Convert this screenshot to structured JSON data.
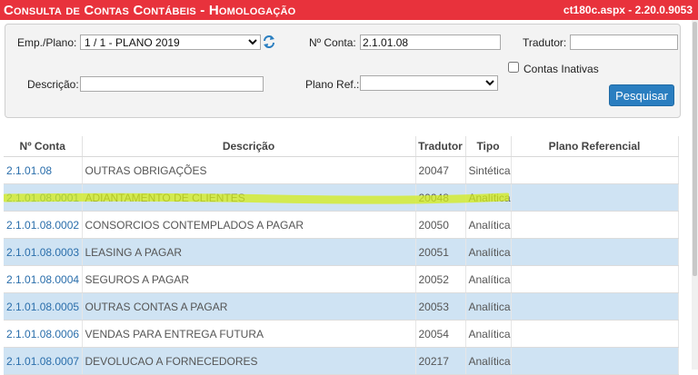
{
  "header": {
    "title": "Consulta de Contas Contábeis  - Homologação",
    "version": "ct180c.aspx - 2.20.0.9053",
    "color": "#e8323c"
  },
  "filters": {
    "emp_plano_label": "Emp./Plano:",
    "emp_plano_value": "1 / 1 - PLANO 2019",
    "conta_label": "Nº Conta:",
    "conta_value": "2.1.01.08",
    "tradutor_label": "Tradutor:",
    "tradutor_value": "",
    "contas_inativas_label": "Contas Inativas",
    "contas_inativas_checked": false,
    "descricao_label": "Descrição:",
    "descricao_value": "",
    "plano_ref_label": "Plano Ref.:",
    "plano_ref_value": "",
    "search_button": "Pesquisar",
    "refresh_icon": "refresh-icon"
  },
  "table": {
    "columns": [
      "Nº Conta",
      "Descrição",
      "Tradutor",
      "Tipo",
      "Plano Referencial"
    ],
    "rows": [
      {
        "conta": "2.1.01.08",
        "descricao": "OUTRAS OBRIGAÇÕES",
        "tradutor": "20047",
        "tipo": "Sintética",
        "plano_ref": ""
      },
      {
        "conta": "2.1.01.08.0001",
        "descricao": "ADIANTAMENTO DE CLIENTES",
        "tradutor": "20048",
        "tipo": "Analítica",
        "plano_ref": ""
      },
      {
        "conta": "2.1.01.08.0002",
        "descricao": "CONSORCIOS CONTEMPLADOS A PAGAR",
        "tradutor": "20050",
        "tipo": "Analítica",
        "plano_ref": ""
      },
      {
        "conta": "2.1.01.08.0003",
        "descricao": "LEASING A PAGAR",
        "tradutor": "20051",
        "tipo": "Analítica",
        "plano_ref": ""
      },
      {
        "conta": "2.1.01.08.0004",
        "descricao": "SEGUROS A PAGAR",
        "tradutor": "20052",
        "tipo": "Analítica",
        "plano_ref": ""
      },
      {
        "conta": "2.1.01.08.0005",
        "descricao": "OUTRAS CONTAS A PAGAR",
        "tradutor": "20053",
        "tipo": "Analítica",
        "plano_ref": ""
      },
      {
        "conta": "2.1.01.08.0006",
        "descricao": "VENDAS PARA ENTREGA FUTURA",
        "tradutor": "20054",
        "tipo": "Analítica",
        "plano_ref": ""
      },
      {
        "conta": "2.1.01.08.0007",
        "descricao": "DEVOLUCAO A FORNECEDORES",
        "tradutor": "20217",
        "tipo": "Analítica",
        "plano_ref": ""
      }
    ],
    "highlight_color": "#d4ec1a",
    "alt_row_color": "#cfe3f3",
    "link_color": "#2a6eab"
  }
}
